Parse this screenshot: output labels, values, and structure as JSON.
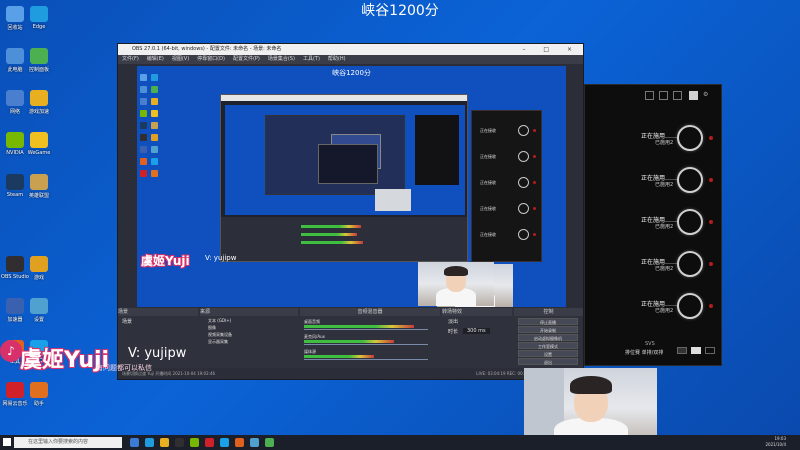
{
  "stream_title": "峡谷1200分",
  "desktop_icons": [
    {
      "label": "回收站",
      "color": "#5aa0e8"
    },
    {
      "label": "Edge",
      "color": "#1f9be0"
    },
    {
      "label": "此电脑",
      "color": "#4d8fd8"
    },
    {
      "label": "控制面板",
      "color": "#4cb050"
    },
    {
      "label": "网络",
      "color": "#4a7fd0"
    },
    {
      "label": "游戏加速",
      "color": "#e8b020"
    },
    {
      "label": "NVIDIA",
      "color": "#76b900"
    },
    {
      "label": "WeGame",
      "color": "#f0c020"
    },
    {
      "label": "Steam",
      "color": "#1a3a60"
    },
    {
      "label": "英雄联盟",
      "color": "#c8a050"
    },
    {
      "label": "OBS Studio",
      "color": "#302e31"
    },
    {
      "label": "游戏",
      "color": "#e0a020"
    },
    {
      "label": "加速器",
      "color": "#3a60b0"
    },
    {
      "label": "设置",
      "color": "#50a0d0"
    },
    {
      "label": "工具",
      "color": "#e06020"
    },
    {
      "label": "QQ",
      "color": "#1aa0e8"
    },
    {
      "label": "网易云音乐",
      "color": "#d0202a"
    },
    {
      "label": "助手",
      "color": "#e07020"
    }
  ],
  "obs": {
    "title": "OBS 27.0.1 (64-bit, windows) - 配置文件: 未命名 - 场景: 未命名",
    "menu": [
      "文件(F)",
      "编辑(E)",
      "视图(V)",
      "停靠窗口(D)",
      "配置文件(P)",
      "场景集合(S)",
      "工具(T)",
      "帮助(H)"
    ],
    "docks": {
      "scenes_header": "场景",
      "sources_header": "来源",
      "mixer_header": "音频混音器",
      "transitions_header": "转场特效",
      "controls_header": "控制"
    },
    "scene_items": [
      "场景"
    ],
    "sources": [
      "文本 (GDI+)",
      "图像",
      "视频采集设备",
      "显示器采集"
    ],
    "mixer_tracks": [
      "桌面音频",
      "麦克风/Aux",
      "媒体源"
    ],
    "transition": "淡出",
    "transition_duration_label": "时长",
    "transition_duration": "300 ms",
    "controls": [
      "停止直播",
      "开始录制",
      "启动虚拟摄像机",
      "工作室模式",
      "设置",
      "退出"
    ],
    "status": "LIVE: 03:04:19  REC: 00:00:00  CPU: 3.7%, 60.00 fps",
    "status_left": "场景切换过渡  Yuji  开播时间 2021-10-04 19:03:46"
  },
  "small_panel_rows": [
    "正在接收",
    "正在接收",
    "正在接收",
    "正在接收",
    "正在接收"
  ],
  "big_panel": {
    "rows": [
      {
        "line1": "正在施用……",
        "line2": "已施用2"
      },
      {
        "line1": "正在施用……",
        "line2": "已施用2"
      },
      {
        "line1": "正在施用……",
        "line2": "已施用2"
      },
      {
        "line1": "正在施用……",
        "line2": "已施用2"
      },
      {
        "line1": "正在施用……",
        "line2": "已施用2"
      }
    ],
    "footer_small": "SVS",
    "footer": "排位赛 单排/双排"
  },
  "watermark": {
    "logo": "虞姬Yuji",
    "v_label": "V: yujipw",
    "sub": "有问题都可以私信"
  },
  "taskbar": {
    "search_placeholder": "在这里输入你要搜索的内容",
    "time": "19:03",
    "date": "2021/10/4"
  },
  "colors": {
    "desktop": "#0b63d6",
    "obs_bg": "#2b2e38",
    "panel_bg": "#0d0d0e",
    "accent_red": "#b51c1c",
    "watermark_pink": "#d8306a"
  }
}
